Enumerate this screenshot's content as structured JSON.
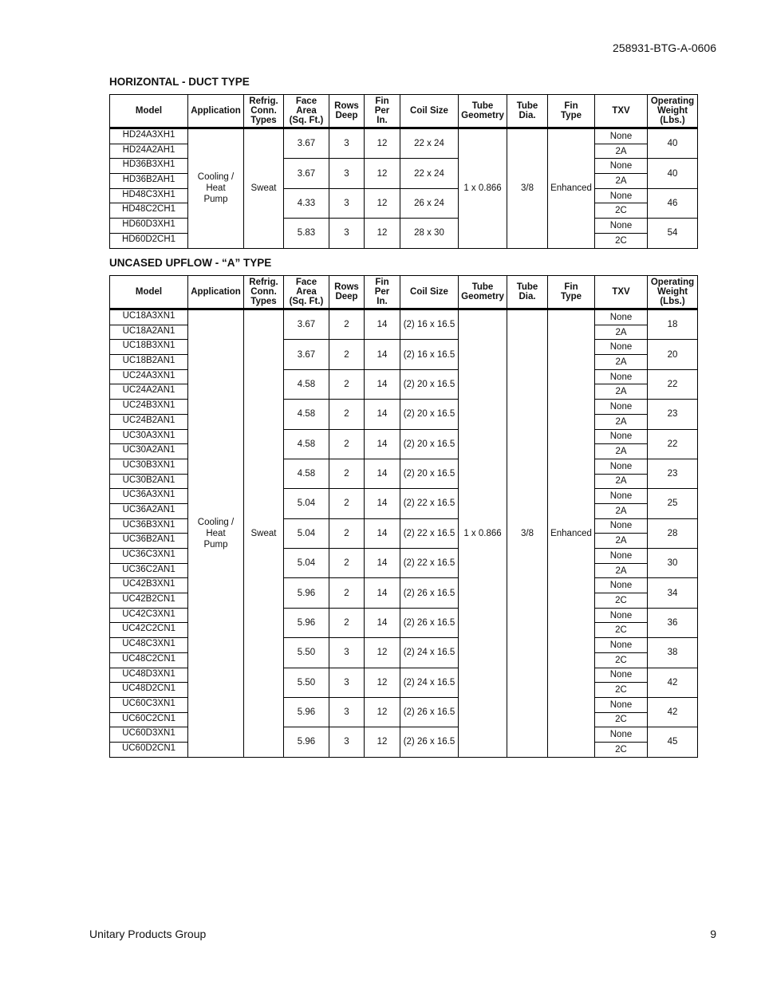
{
  "header": {
    "doc_id": "258931-BTG-A-0606"
  },
  "columns": [
    "Model",
    "Application",
    "Refrig. Conn. Types",
    "Face Area (Sq. Ft.)",
    "Rows Deep",
    "Fin Per In.",
    "Coil Size",
    "Tube Geometry",
    "Tube Dia.",
    "Fin Type",
    "TXV",
    "Operating Weight (Lbs.)"
  ],
  "column_lines": [
    [
      "Model"
    ],
    [
      "Application"
    ],
    [
      "Refrig.",
      "Conn.",
      "Types"
    ],
    [
      "Face",
      "Area",
      "(Sq. Ft.)"
    ],
    [
      "Rows",
      "Deep"
    ],
    [
      "Fin",
      "Per",
      "In."
    ],
    [
      "Coil Size"
    ],
    [
      "Tube",
      "Geometry"
    ],
    [
      "Tube",
      "Dia."
    ],
    [
      "Fin",
      "Type"
    ],
    [
      "TXV"
    ],
    [
      "Operating",
      "Weight",
      "(Lbs.)"
    ]
  ],
  "tables": [
    {
      "title": "HORIZONTAL - DUCT TYPE",
      "application": "Cooling / Heat Pump",
      "refrig_conn": "Sweat",
      "tube_geometry": "1 x 0.866",
      "tube_dia": "3/8",
      "fin_type": "Enhanced",
      "groups": [
        {
          "models": [
            "HD24A3XH1",
            "HD24A2AH1"
          ],
          "face_area": "3.67",
          "rows_deep": "3",
          "fin_per_in": "12",
          "coil_size": "22 x 24",
          "txv": [
            "None",
            "2A"
          ],
          "weight": "40"
        },
        {
          "models": [
            "HD36B3XH1",
            "HD36B2AH1"
          ],
          "face_area": "3.67",
          "rows_deep": "3",
          "fin_per_in": "12",
          "coil_size": "22 x 24",
          "txv": [
            "None",
            "2A"
          ],
          "weight": "40"
        },
        {
          "models": [
            "HD48C3XH1",
            "HD48C2CH1"
          ],
          "face_area": "4.33",
          "rows_deep": "3",
          "fin_per_in": "12",
          "coil_size": "26 x 24",
          "txv": [
            "None",
            "2C"
          ],
          "weight": "46"
        },
        {
          "models": [
            "HD60D3XH1",
            "HD60D2CH1"
          ],
          "face_area": "5.83",
          "rows_deep": "3",
          "fin_per_in": "12",
          "coil_size": "28 x 30",
          "txv": [
            "None",
            "2C"
          ],
          "weight": "54"
        }
      ]
    },
    {
      "title": "UNCASED UPFLOW - “A” TYPE",
      "application": "Cooling / Heat Pump",
      "refrig_conn": "Sweat",
      "tube_geometry": "1 x 0.866",
      "tube_dia": "3/8",
      "fin_type": "Enhanced",
      "groups": [
        {
          "models": [
            "UC18A3XN1",
            "UC18A2AN1"
          ],
          "face_area": "3.67",
          "rows_deep": "2",
          "fin_per_in": "14",
          "coil_size": "(2) 16 x 16.5",
          "txv": [
            "None",
            "2A"
          ],
          "weight": "18"
        },
        {
          "models": [
            "UC18B3XN1",
            "UC18B2AN1"
          ],
          "face_area": "3.67",
          "rows_deep": "2",
          "fin_per_in": "14",
          "coil_size": "(2) 16 x 16.5",
          "txv": [
            "None",
            "2A"
          ],
          "weight": "20"
        },
        {
          "models": [
            "UC24A3XN1",
            "UC24A2AN1"
          ],
          "face_area": "4.58",
          "rows_deep": "2",
          "fin_per_in": "14",
          "coil_size": "(2) 20 x 16.5",
          "txv": [
            "None",
            "2A"
          ],
          "weight": "22"
        },
        {
          "models": [
            "UC24B3XN1",
            "UC24B2AN1"
          ],
          "face_area": "4.58",
          "rows_deep": "2",
          "fin_per_in": "14",
          "coil_size": "(2) 20 x 16.5",
          "txv": [
            "None",
            "2A"
          ],
          "weight": "23"
        },
        {
          "models": [
            "UC30A3XN1",
            "UC30A2AN1"
          ],
          "face_area": "4.58",
          "rows_deep": "2",
          "fin_per_in": "14",
          "coil_size": "(2) 20 x 16.5",
          "txv": [
            "None",
            "2A"
          ],
          "weight": "22"
        },
        {
          "models": [
            "UC30B3XN1",
            "UC30B2AN1"
          ],
          "face_area": "4.58",
          "rows_deep": "2",
          "fin_per_in": "14",
          "coil_size": "(2) 20 x 16.5",
          "txv": [
            "None",
            "2A"
          ],
          "weight": "23"
        },
        {
          "models": [
            "UC36A3XN1",
            "UC36A2AN1"
          ],
          "face_area": "5.04",
          "rows_deep": "2",
          "fin_per_in": "14",
          "coil_size": "(2) 22 x 16.5",
          "txv": [
            "None",
            "2A"
          ],
          "weight": "25"
        },
        {
          "models": [
            "UC36B3XN1",
            "UC36B2AN1"
          ],
          "face_area": "5.04",
          "rows_deep": "2",
          "fin_per_in": "14",
          "coil_size": "(2) 22 x 16.5",
          "txv": [
            "None",
            "2A"
          ],
          "weight": "28"
        },
        {
          "models": [
            "UC36C3XN1",
            "UC36C2AN1"
          ],
          "face_area": "5.04",
          "rows_deep": "2",
          "fin_per_in": "14",
          "coil_size": "(2) 22 x 16.5",
          "txv": [
            "None",
            "2A"
          ],
          "weight": "30"
        },
        {
          "models": [
            "UC42B3XN1",
            "UC42B2CN1"
          ],
          "face_area": "5.96",
          "rows_deep": "2",
          "fin_per_in": "14",
          "coil_size": "(2) 26 x 16.5",
          "txv": [
            "None",
            "2C"
          ],
          "weight": "34"
        },
        {
          "models": [
            "UC42C3XN1",
            "UC42C2CN1"
          ],
          "face_area": "5.96",
          "rows_deep": "2",
          "fin_per_in": "14",
          "coil_size": "(2) 26 x 16.5",
          "txv": [
            "None",
            "2C"
          ],
          "weight": "36"
        },
        {
          "models": [
            "UC48C3XN1",
            "UC48C2CN1"
          ],
          "face_area": "5.50",
          "rows_deep": "3",
          "fin_per_in": "12",
          "coil_size": "(2) 24 x 16.5",
          "txv": [
            "None",
            "2C"
          ],
          "weight": "38"
        },
        {
          "models": [
            "UC48D3XN1",
            "UC48D2CN1"
          ],
          "face_area": "5.50",
          "rows_deep": "3",
          "fin_per_in": "12",
          "coil_size": "(2) 24 x 16.5",
          "txv": [
            "None",
            "2C"
          ],
          "weight": "42"
        },
        {
          "models": [
            "UC60C3XN1",
            "UC60C2CN1"
          ],
          "face_area": "5.96",
          "rows_deep": "3",
          "fin_per_in": "12",
          "coil_size": "(2) 26 x 16.5",
          "txv": [
            "None",
            "2C"
          ],
          "weight": "42"
        },
        {
          "models": [
            "UC60D3XN1",
            "UC60D2CN1"
          ],
          "face_area": "5.96",
          "rows_deep": "3",
          "fin_per_in": "12",
          "coil_size": "(2) 26 x 16.5",
          "txv": [
            "None",
            "2C"
          ],
          "weight": "45"
        }
      ]
    }
  ],
  "footer": {
    "left": "Unitary Products Group",
    "page_number": "9"
  }
}
